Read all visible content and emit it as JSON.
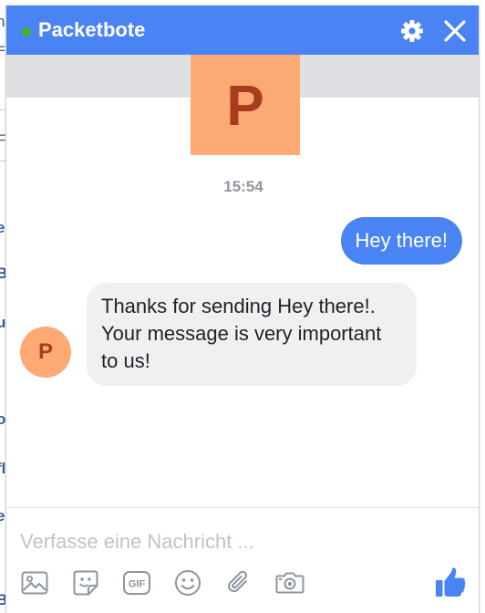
{
  "background_page": {
    "glyphs": [
      "n",
      "=",
      "F",
      "e",
      "B",
      "uj",
      "ol",
      "fl",
      "el",
      "Bl"
    ]
  },
  "chat": {
    "title": "Packetbote",
    "status": "online",
    "header_color": "#4a83f3",
    "online_color": "#42b72a",
    "header_icons": [
      "gear-icon",
      "close-icon"
    ]
  },
  "profile": {
    "initial": "P",
    "avatar_color": "#fda974",
    "initial_color": "#a93b1e"
  },
  "conversation": {
    "timestamp": "15:54",
    "messages": [
      {
        "direction": "outgoing",
        "text": "Hey there!"
      },
      {
        "direction": "incoming",
        "text": "Thanks for sending Hey there!. Your message is very important to us!"
      }
    ]
  },
  "composer": {
    "placeholder": "Verfasse eine Nachricht ...",
    "value": "",
    "tools": [
      "photo-icon",
      "sticker-icon",
      "gif-icon",
      "emoji-icon",
      "attachment-icon",
      "camera-icon"
    ],
    "gif_label": "GIF",
    "send_icon": "thumbs-up-icon"
  }
}
